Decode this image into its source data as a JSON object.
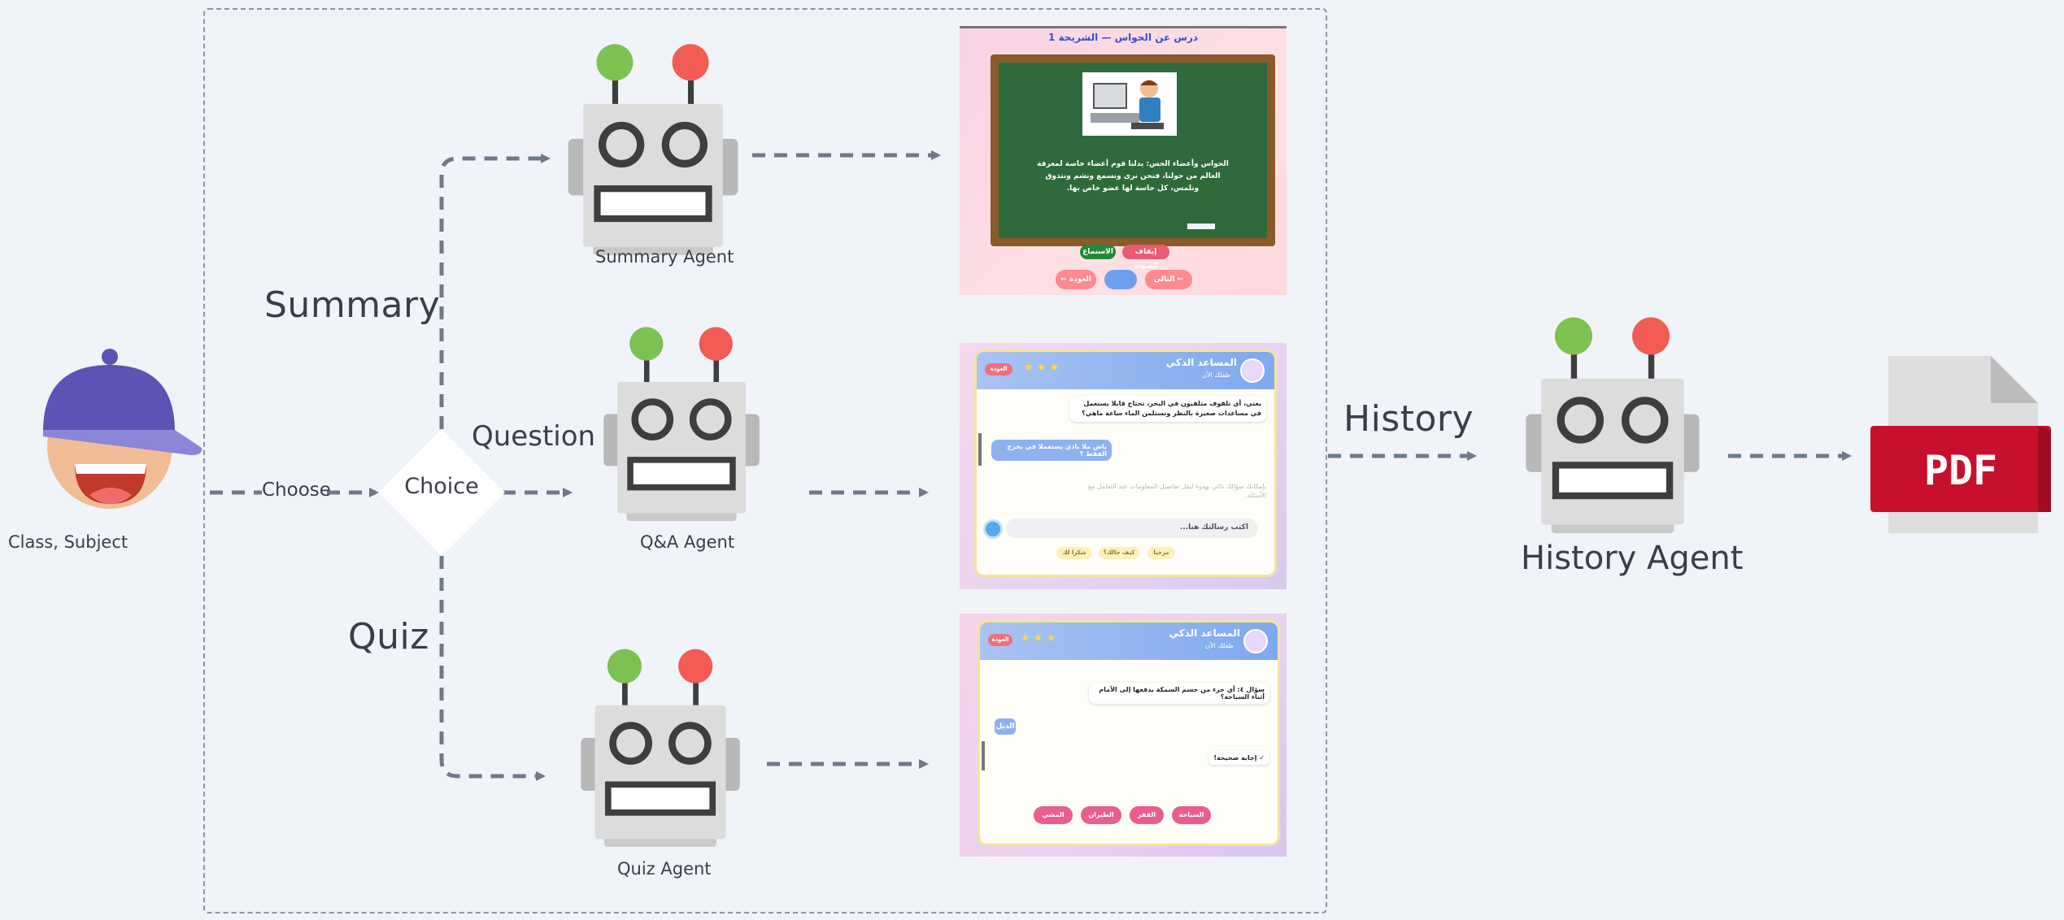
{
  "diagram": {
    "student_label": "Class, Subject",
    "choose_label": "Choose",
    "choice_label": "Choice",
    "summary_label": "Summary",
    "question_label": "Question",
    "quiz_label": "Quiz",
    "history_label": "History",
    "agents": {
      "summary": "Summary Agent",
      "qa": "Q&A Agent",
      "quiz": "Quiz Agent",
      "history": "History Agent"
    },
    "pdf_label": "PDF"
  },
  "colors": {
    "background": "#f0f3f7",
    "arrow": "#6e7a89",
    "robot_body": "#dcdcdc",
    "antenna_green": "#7cc152",
    "antenna_red": "#f25c54",
    "cap": "#5b54b4",
    "pdf_red": "#c8102e"
  },
  "summary_screen": {
    "title": "درس عن الحواس — الشريحة 1",
    "board_text": "الحواس وأعضاء الحس: يدلنا قوم أعضاء خاصة لمعرفة العالم من حولنا، فنحن نرى ونسمع ونشم ونتذوق ونلمس، كل حاسة لها عضو خاص بها.",
    "listen_button": "الاستماع",
    "stop_button": "إيقاف الصوت",
    "back_button": "← العودة",
    "next_button": "التالي ←"
  },
  "qa_screen": {
    "assistant_title": "المساعد الذكي",
    "assistant_subtitle": "طفلك الآن",
    "back_button": "العودة",
    "bot_message": "يعني، أي تلقوف مثلفيون في البحر، تحتاج قابلا يستعمل في مساعدات صغيرة بالنظر وتستلمن الماء ساعة ماهي؟",
    "user_message": "ياش ملا يادي يستعملا في يخرج الفقط ؟",
    "faded_message": "بإمكانك سؤالك دائي بهدوء لنقل تفاصيل المعلومات عند التعامل مع الأسئلة.",
    "input_placeholder": "اكتب رسالتك هنا...",
    "chips": [
      "مرحبا",
      "كيف حالك؟",
      "شكرا لك"
    ]
  },
  "quiz_screen": {
    "assistant_title": "المساعد الذكي",
    "assistant_subtitle": "طفلك الآن",
    "back_button": "العودة",
    "question": "سؤال ٤: أي جزء من جسم السمكة يدفعها إلى الأمام أثناء السباحة؟",
    "user_answer": "الذيل",
    "feedback": "✓ إجابة صحيحة!",
    "options": [
      "السباحة",
      "القفز",
      "الطيران",
      "المشي"
    ]
  }
}
